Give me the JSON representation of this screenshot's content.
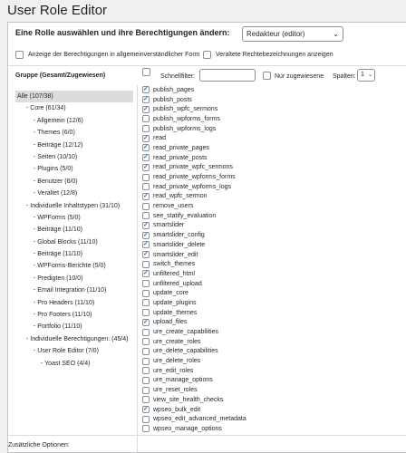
{
  "page_title": "User Role Editor",
  "role_prompt": "Eine Rolle auswählen und ihre Berechtigungen ändern:",
  "role_selected": "Redakteur (editor)",
  "options": [
    {
      "label": "Anzeige der Berechtigungen in allgemeinverständlicher Form",
      "checked": false
    },
    {
      "label": "Veraltete Rechtebezeichnungen anzeigen",
      "checked": false
    }
  ],
  "group_header": "Gruppe (Gesamt/Zugewiesen)",
  "groups": [
    {
      "label": "Alle (107/38)",
      "level": 0,
      "selected": true
    },
    {
      "label": "- Core (61/34)",
      "level": 1
    },
    {
      "label": "- Allgemein (12/6)",
      "level": 2
    },
    {
      "label": "- Themes (6/0)",
      "level": 2
    },
    {
      "label": "- Beiträge (12/12)",
      "level": 2
    },
    {
      "label": "- Seiten (10/10)",
      "level": 2
    },
    {
      "label": "- Plugins (5/0)",
      "level": 2
    },
    {
      "label": "- Benutzer (6/0)",
      "level": 2
    },
    {
      "label": "- Veraltet (12/8)",
      "level": 2
    },
    {
      "label": "- Individuelle Inhaltstypen (31/10)",
      "level": 1
    },
    {
      "label": "- WPForms (5/0)",
      "level": 2
    },
    {
      "label": "- Beiträge (11/10)",
      "level": 2
    },
    {
      "label": "- Global Blocks (11/10)",
      "level": 2
    },
    {
      "label": "- Beiträge (11/10)",
      "level": 2
    },
    {
      "label": "- WPForms-Berichte (5/0)",
      "level": 2
    },
    {
      "label": "- Predigten (10/0)",
      "level": 2
    },
    {
      "label": "- Email Integration (11/10)",
      "level": 2
    },
    {
      "label": "- Pro Headers (11/10)",
      "level": 2
    },
    {
      "label": "- Pro Footers (11/10)",
      "level": 2
    },
    {
      "label": "- Portfolio (11/10)",
      "level": 2
    },
    {
      "label": "- Individuelle Berechtigungen: (45/4)",
      "level": 1
    },
    {
      "label": "- User Role Editor (7/0)",
      "level": 2
    },
    {
      "label": "- Yoast SEO (4/4)",
      "level": 3
    }
  ],
  "toolbar": {
    "filter_label": "Schnellfilter:",
    "filter_value": "",
    "only_granted_label": "Nur zugewiesene",
    "columns_label": "Spalten:",
    "columns_value": "1"
  },
  "capabilities": [
    {
      "name": "publish_pages",
      "checked": true
    },
    {
      "name": "publish_posts",
      "checked": true
    },
    {
      "name": "publish_wpfc_sermons",
      "checked": true
    },
    {
      "name": "publish_wpforms_forms",
      "checked": false
    },
    {
      "name": "publish_wpforms_logs",
      "checked": false
    },
    {
      "name": "read",
      "checked": true
    },
    {
      "name": "read_private_pages",
      "checked": true
    },
    {
      "name": "read_private_posts",
      "checked": true
    },
    {
      "name": "read_private_wpfc_sermons",
      "checked": true
    },
    {
      "name": "read_private_wpforms_forms",
      "checked": false
    },
    {
      "name": "read_private_wpforms_logs",
      "checked": false
    },
    {
      "name": "read_wpfc_sermon",
      "checked": true
    },
    {
      "name": "remove_users",
      "checked": false
    },
    {
      "name": "see_statify_evaluation",
      "checked": false
    },
    {
      "name": "smartslider",
      "checked": true
    },
    {
      "name": "smartslider_config",
      "checked": true
    },
    {
      "name": "smartslider_delete",
      "checked": true
    },
    {
      "name": "smartslider_edit",
      "checked": true
    },
    {
      "name": "switch_themes",
      "checked": false
    },
    {
      "name": "unfiltered_html",
      "checked": true
    },
    {
      "name": "unfiltered_upload",
      "checked": false
    },
    {
      "name": "update_core",
      "checked": false
    },
    {
      "name": "update_plugins",
      "checked": false
    },
    {
      "name": "update_themes",
      "checked": false
    },
    {
      "name": "upload_files",
      "checked": true
    },
    {
      "name": "ure_create_capabilities",
      "checked": false
    },
    {
      "name": "ure_create_roles",
      "checked": false
    },
    {
      "name": "ure_delete_capabilities",
      "checked": false
    },
    {
      "name": "ure_delete_roles",
      "checked": false
    },
    {
      "name": "ure_edit_roles",
      "checked": false
    },
    {
      "name": "ure_manage_options",
      "checked": false
    },
    {
      "name": "ure_reset_roles",
      "checked": false
    },
    {
      "name": "view_site_health_checks",
      "checked": false
    },
    {
      "name": "wpseo_bulk_edit",
      "checked": true
    },
    {
      "name": "wpseo_edit_advanced_metadata",
      "checked": false
    },
    {
      "name": "wpseo_manage_options",
      "checked": false
    }
  ],
  "footer_label": "Zusätzliche Optionen:"
}
